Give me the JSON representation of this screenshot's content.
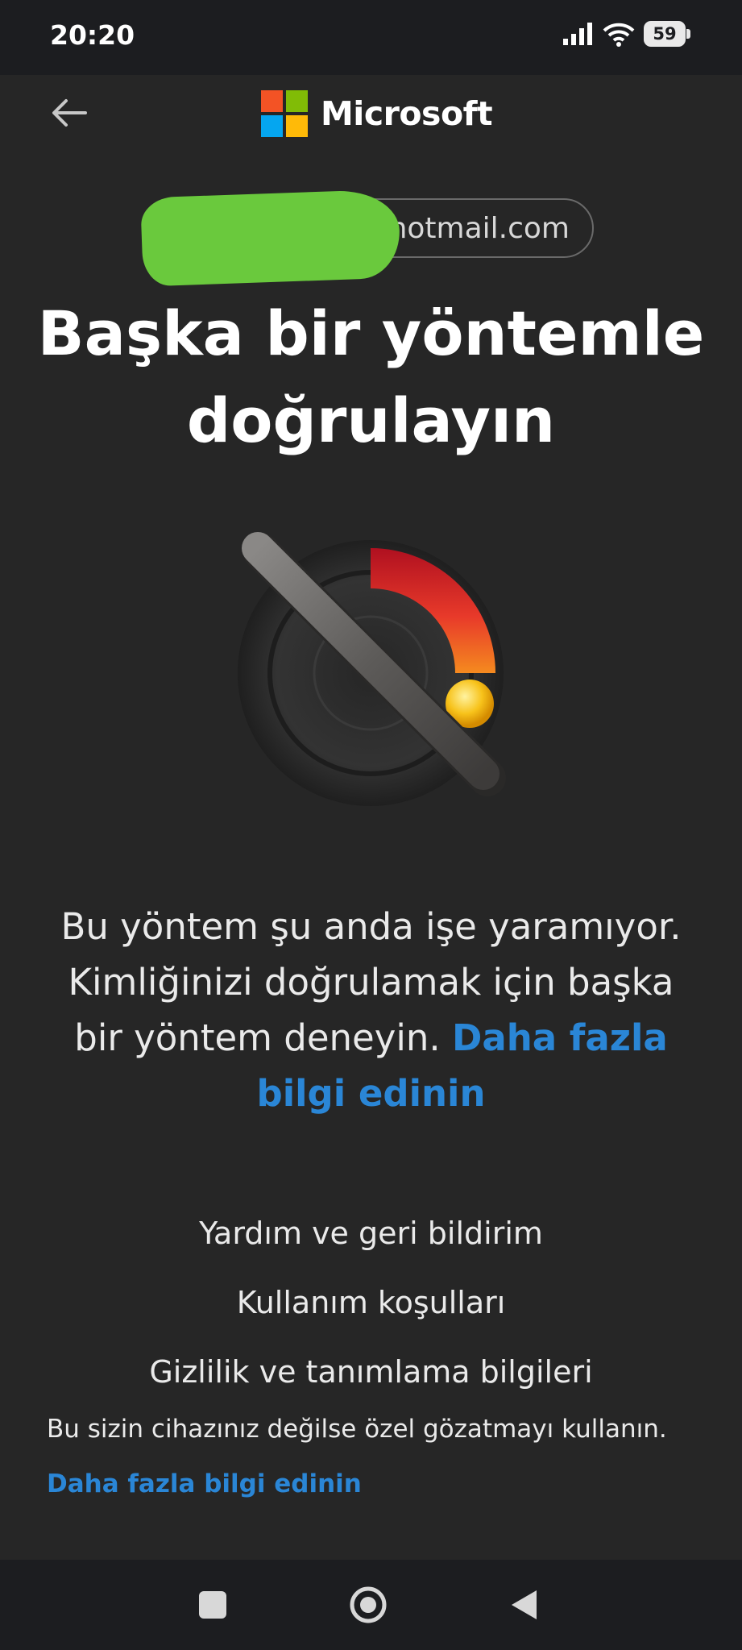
{
  "status_bar": {
    "time": "20:20",
    "battery_level": "59"
  },
  "header": {
    "brand_name": "Microsoft"
  },
  "account": {
    "email": "@hotmail.com"
  },
  "title_lines": [
    "Başka bir yöntemle",
    "doğrulayın"
  ],
  "message": {
    "text": "Bu yöntem şu anda işe yaramıyor. Kimliğinizi doğrulamak için başka bir yöntem deneyin. ",
    "link": "Daha fazla bilgi edinin"
  },
  "footer": {
    "links": [
      "Yardım ve geri bildirim",
      "Kullanım koşulları",
      "Gizlilik ve tanımlama bilgileri"
    ],
    "notice": "Bu sizin cihazınız değilse özel gözatmayı kullanın.",
    "notice_link": "Daha fazla bilgi edinin"
  },
  "colors": {
    "ms_red": "#f35325",
    "ms_green": "#81bc06",
    "ms_blue": "#05a6f0",
    "ms_yellow": "#ffba08",
    "link": "#2a86d6",
    "redaction": "#6ac93d"
  }
}
